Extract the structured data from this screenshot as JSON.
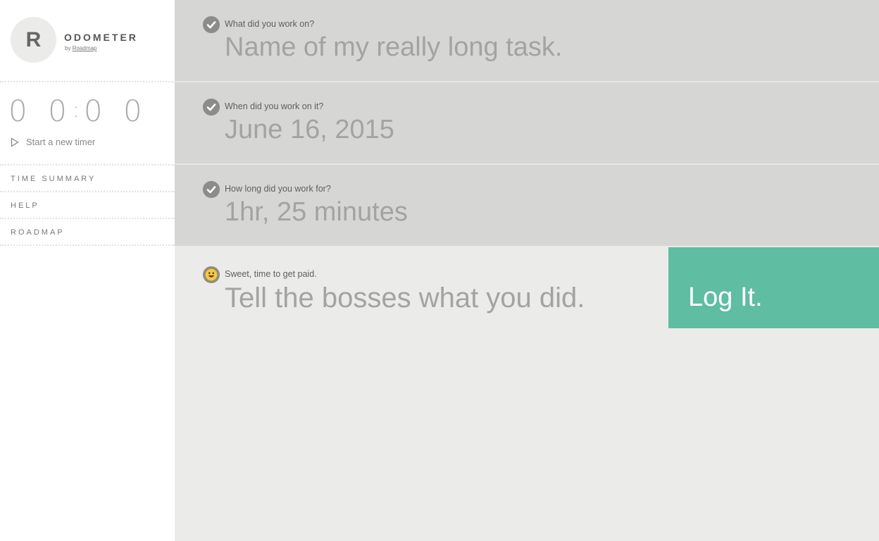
{
  "brand": {
    "logo_letter": "R",
    "name": "ODOMETER",
    "by_prefix": "by",
    "by_link": "Roadmap"
  },
  "timer": {
    "hours": "0 0",
    "colon": ":",
    "minutes": "0 0",
    "start_label": "Start a new timer"
  },
  "nav": {
    "items": [
      {
        "label": "TIME SUMMARY"
      },
      {
        "label": "HELP"
      },
      {
        "label": "ROADMAP"
      }
    ]
  },
  "questions": [
    {
      "label": "What did you work on?",
      "answer": "Name of my really long task."
    },
    {
      "label": "When did you work on it?",
      "answer": "June 16, 2015"
    },
    {
      "label": "How long did you work for?",
      "answer": "1hr, 25 minutes"
    }
  ],
  "final": {
    "label": "Sweet, time to get paid.",
    "answer": "Tell the bosses what you did."
  },
  "action": {
    "label": "Log It."
  },
  "colors": {
    "accent": "#5fbda1",
    "question_bg": "#d6d6d5",
    "main_bg": "#ebebea",
    "check_bg": "#8c8c8a"
  },
  "icons": {
    "check": "check-circle-icon",
    "smile": "smile-emoji-icon",
    "play": "play-outline-icon"
  }
}
